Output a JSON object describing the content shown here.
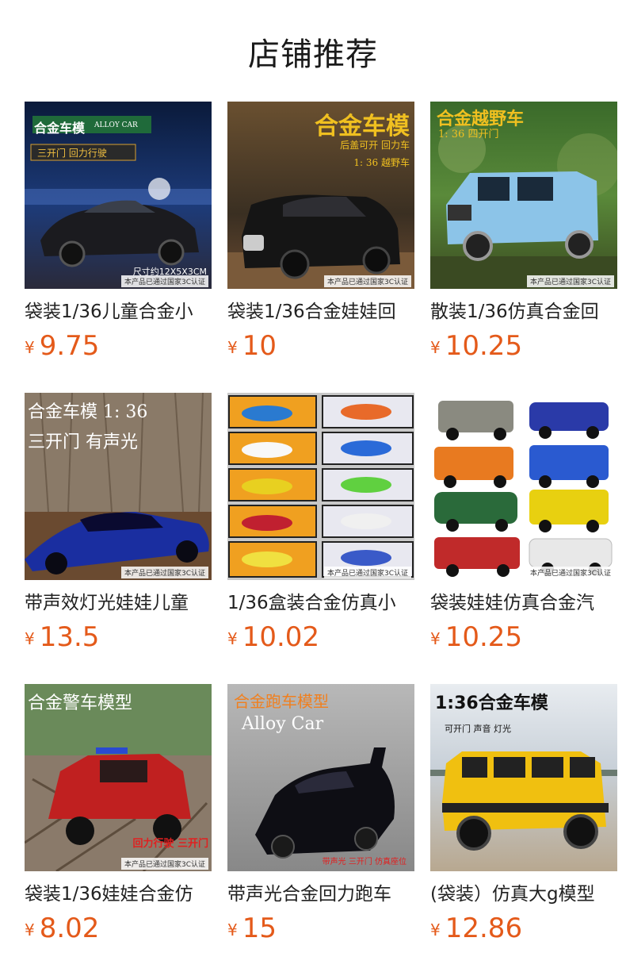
{
  "header": {
    "title": "店铺推荐"
  },
  "products": [
    {
      "name": "袋装1/36儿童合金小",
      "currency": "¥",
      "price": "9.75",
      "overlay": {
        "line1": "合金车模",
        "line1b": "ALLOY CAR",
        "line2": "三开门 回力行驶",
        "size": "尺寸约12X5X3CM",
        "badge": "本产品已通过国家3C认证"
      }
    },
    {
      "name": "袋装1/36合金娃娃回",
      "currency": "¥",
      "price": "10",
      "overlay": {
        "line1": "合金车模",
        "line2": "后盖可开 回力车",
        "line3": "1: 36 越野车",
        "badge": "本产品已通过国家3C认证"
      }
    },
    {
      "name": "散装1/36仿真合金回",
      "currency": "¥",
      "price": "10.25",
      "overlay": {
        "line1": "合金越野车",
        "line2": "1: 36 四开门",
        "badge": "本产品已通过国家3C认证"
      }
    },
    {
      "name": "带声效灯光娃娃儿童",
      "currency": "¥",
      "price": "13.5",
      "overlay": {
        "line1": "合金车模 1: 36",
        "line2": "三开门 有声光",
        "badge": "本产品已通过国家3C认证"
      }
    },
    {
      "name": "1/36盒装合金仿真小",
      "currency": "¥",
      "price": "10.02",
      "overlay": {
        "badge": "本产品已通过国家3C认证"
      }
    },
    {
      "name": "袋装娃娃仿真合金汽",
      "currency": "¥",
      "price": "10.25",
      "overlay": {
        "badge": "本产品已通过国家3C认证"
      }
    },
    {
      "name": "袋装1/36娃娃合金仿",
      "currency": "¥",
      "price": "8.02",
      "overlay": {
        "line1": "合金警车模型",
        "line2": "回力行驶 三开门",
        "badge": "本产品已通过国家3C认证"
      }
    },
    {
      "name": "带声光合金回力跑车",
      "currency": "¥",
      "price": "15",
      "overlay": {
        "line1": "合金跑车模型",
        "line2": "Alloy Car",
        "line3": "带声光 三开门 仿真座位"
      }
    },
    {
      "name": "(袋装）仿真大g模型",
      "currency": "¥",
      "price": "12.86",
      "overlay": {
        "line1": "1:36合金车模",
        "line2": "可开门 声音 灯光"
      }
    }
  ],
  "colors": {
    "price": "#e45a1a",
    "title": "#1a1a1a"
  }
}
